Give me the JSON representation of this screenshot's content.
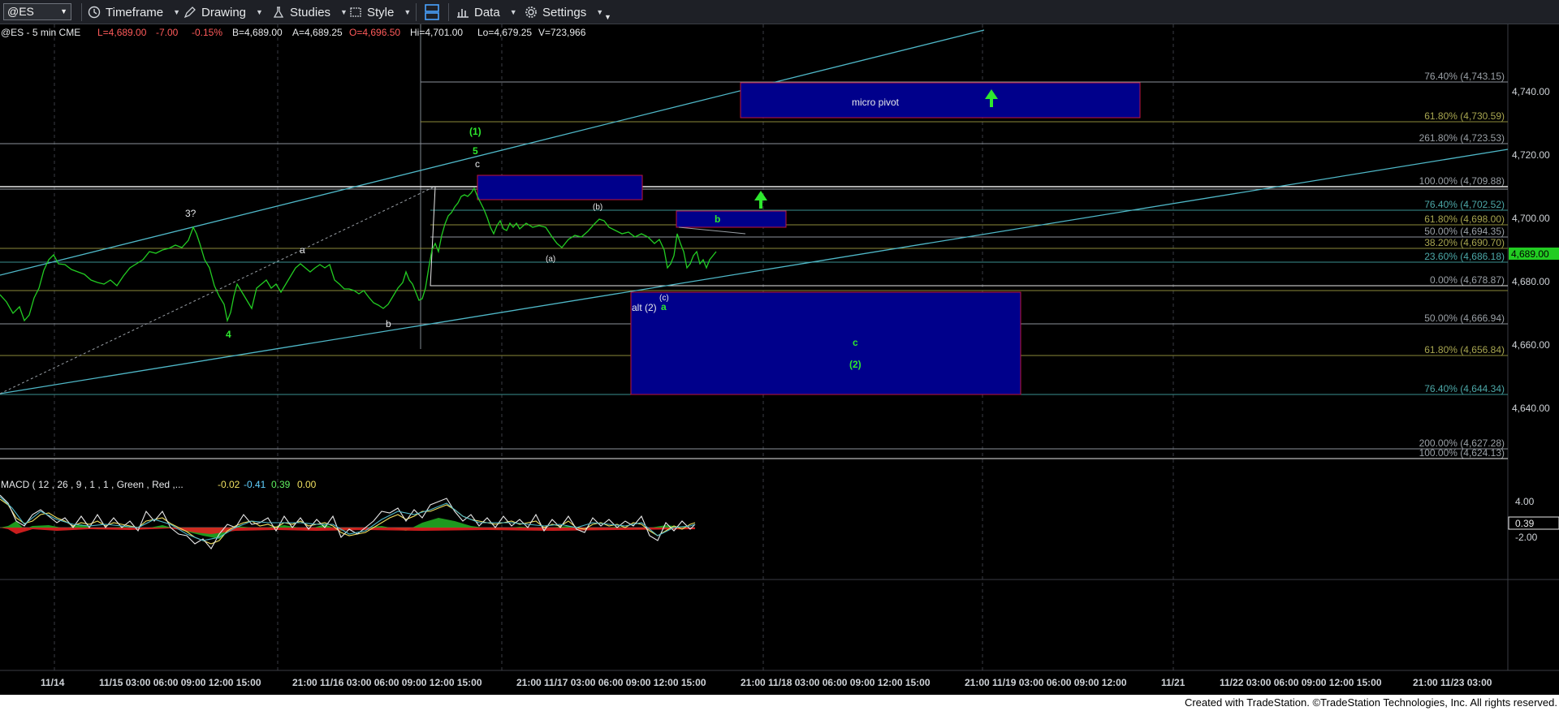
{
  "toolbar": {
    "symbol": "@ES",
    "timeframe": "Timeframe",
    "drawing": "Drawing",
    "studies": "Studies",
    "style": "Style",
    "data": "Data",
    "settings": "Settings"
  },
  "header": {
    "symbol_info": "@ES - 5 min  CME",
    "last": "L=4,689.00",
    "change": "-7.00",
    "pct": "-0.15%",
    "bid": "B=4,689.00",
    "ask": "A=4,689.25",
    "open": "O=4,696.50",
    "high": "Hi=4,701.00",
    "low": "Lo=4,679.25",
    "volume": "V=723,966"
  },
  "colors": {
    "background": "#000000",
    "price_line": "#22cc22",
    "fib_gray": "#8b929a",
    "fib_olive": "#8b8a3a",
    "fib_teal": "#3a8f8f",
    "trend": "#4fb8c8",
    "box_fill": "#00008b",
    "box_border": "#c0143c",
    "price_tag": "#22cc22"
  },
  "price_axis": {
    "ticks": [
      "4,740.00",
      "4,720.00",
      "4,700.00",
      "4,680.00",
      "4,660.00",
      "4,640.00"
    ],
    "current_price": "4,689.00"
  },
  "fib_labels": [
    "76.40% (4,743.15)",
    "61.80% (4,730.59)",
    "261.80% (4,723.53)",
    "100.00% (4,709.88)",
    "76.40% (4,702.52)",
    "61.80% (4,698.00)",
    "50.00% (4,694.35)",
    "38.20% (4,690.70)",
    "23.60% (4,686.18)",
    "0.00% (4,678.87)",
    "50.00% (4,666.94)",
    "61.80% (4,656.84)",
    "76.40% (4,644.34)",
    "200.00% (4,627.28)",
    "100.00% (4,624.13)"
  ],
  "wave_labels": {
    "w1": "(1)",
    "w5": "5",
    "wc_top": "c",
    "w3q": "3?",
    "wa": "a",
    "w4": "4",
    "wb_low": "b",
    "wb_paren": "(b)",
    "wa_paren": "(a)",
    "wc_paren": "(c)",
    "alt2": "alt (2)",
    "wa_green": "a",
    "box_b": "b",
    "box_c": "c",
    "box_2": "(2)",
    "micro_pivot": "micro pivot"
  },
  "macd": {
    "title": "MACD ( 12 , 26 , 9 , 1 , 1 , Green , Red ,...",
    "v1": "-0.02",
    "v2": "-0.41",
    "v3": "0.39",
    "v4": "0.00",
    "axis_top": "4.00",
    "axis_bottom": "-2.00",
    "current": "0.39"
  },
  "time_axis": [
    "11/14",
    "11/15 03:00 06:00 09:00 12:00 15:00",
    "21:00 11/16 03:00 06:00 09:00 12:00 15:00",
    "21:00 11/17 03:00 06:00 09:00 12:00 15:00",
    "21:00 11/18 03:00 06:00 09:00 12:00 15:00",
    "21:00 11/19 03:00 06:00 09:00 12:00",
    "11/21",
    "11/22 03:00 06:00 09:00 12:00 15:00",
    "21:00 11/23 03:00"
  ],
  "footer": "Created with TradeStation. ©TradeStation Technologies, Inc. All rights reserved."
}
